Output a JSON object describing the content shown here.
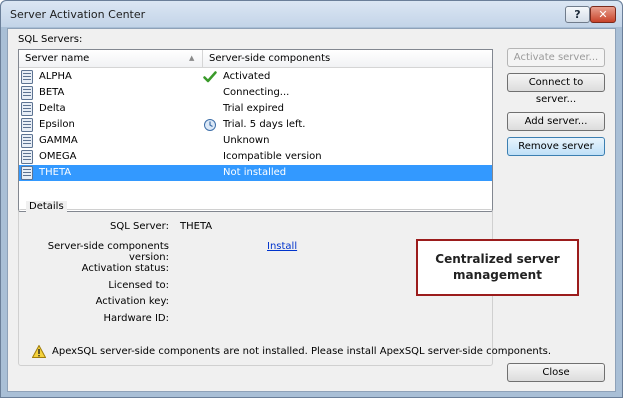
{
  "window": {
    "title": "Server Activation Center",
    "help_label": "?",
    "close_label": "✕"
  },
  "servers": {
    "label": "SQL Servers:",
    "columns": {
      "name": "Server name",
      "components": "Server-side components"
    },
    "rows": [
      {
        "name": "ALPHA",
        "status": "Activated",
        "icon": "check-icon",
        "selected": false
      },
      {
        "name": "BETA",
        "status": "Connecting...",
        "icon": "",
        "selected": false
      },
      {
        "name": "Delta",
        "status": "Trial expired",
        "icon": "",
        "selected": false
      },
      {
        "name": "Epsilon",
        "status": "Trial. 5 days left.",
        "icon": "clock-icon",
        "selected": false
      },
      {
        "name": "GAMMA",
        "status": "Unknown",
        "icon": "",
        "selected": false
      },
      {
        "name": "OMEGA",
        "status": "Icompatible version",
        "icon": "",
        "selected": false
      },
      {
        "name": "THETA",
        "status": "Not installed",
        "icon": "",
        "selected": true
      }
    ]
  },
  "buttons": {
    "activate": "Activate server...",
    "connect": "Connect to server...",
    "add": "Add server...",
    "remove": "Remove server",
    "close": "Close"
  },
  "details": {
    "legend": "Details",
    "sql_server_label": "SQL Server:",
    "sql_server_value": "THETA",
    "components_version_label": "Server-side components version:",
    "install_link": "Install",
    "activation_status_label": "Activation status:",
    "licensed_to_label": "Licensed to:",
    "activation_key_label": "Activation key:",
    "hardware_id_label": "Hardware ID:"
  },
  "warning": "ApexSQL server-side components are not installed. Please install ApexSQL server-side components.",
  "callout": {
    "line1": "Centralized server",
    "line2": "management"
  },
  "colors": {
    "selection": "#3399ff",
    "callout_border": "#9b1c1c",
    "link": "#0033cc"
  }
}
